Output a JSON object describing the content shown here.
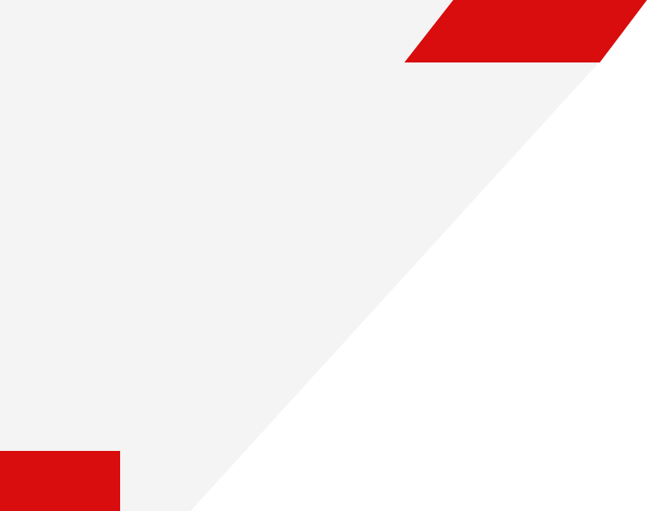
{
  "colors": {
    "background": "#ffffff",
    "panel": "#f4f4f4",
    "accent": "#d90d0d"
  },
  "shapes": [
    {
      "name": "gray-diagonal-panel",
      "color_key": "panel"
    },
    {
      "name": "red-parallelogram-top-right",
      "color_key": "accent"
    },
    {
      "name": "red-block-bottom-left",
      "color_key": "accent"
    }
  ]
}
